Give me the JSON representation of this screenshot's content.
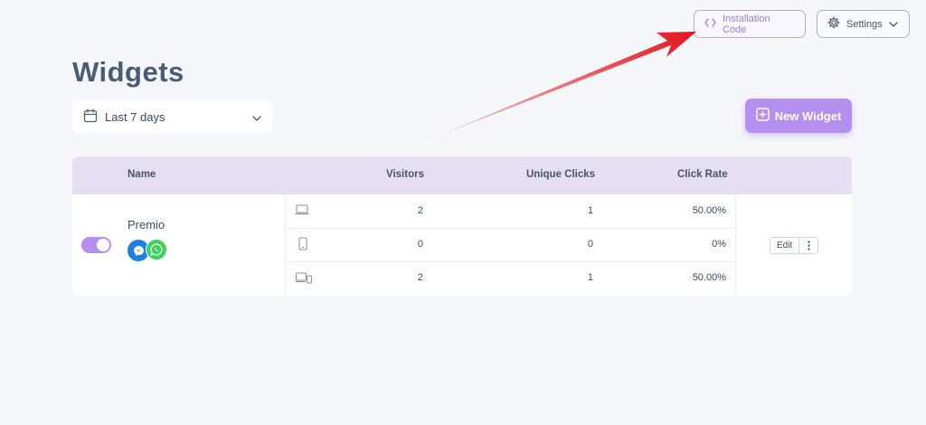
{
  "header": {
    "install_label": "Installation Code",
    "settings_label": "Settings"
  },
  "page": {
    "title": "Widgets",
    "date_filter": "Last 7 days",
    "new_widget_label": "New Widget"
  },
  "table": {
    "columns": {
      "name": "Name",
      "visitors": "Visitors",
      "unique_clicks": "Unique Clicks",
      "click_rate": "Click Rate"
    },
    "widget": {
      "name": "Premio",
      "enabled": true,
      "channels": [
        "messenger-icon",
        "whatsapp-icon"
      ],
      "edit_label": "Edit",
      "rows": [
        {
          "device": "desktop-icon",
          "visitors": "2",
          "unique_clicks": "1",
          "click_rate": "50.00%"
        },
        {
          "device": "mobile-icon",
          "visitors": "0",
          "unique_clicks": "0",
          "click_rate": "0%"
        },
        {
          "device": "all-devices-icon",
          "visitors": "2",
          "unique_clicks": "1",
          "click_rate": "50.00%"
        }
      ]
    }
  },
  "colors": {
    "accent": "#b58ff0",
    "header_bg": "#e6def2",
    "page_bg": "#f6f7fb",
    "annotation_arrow": "#e3151b"
  }
}
